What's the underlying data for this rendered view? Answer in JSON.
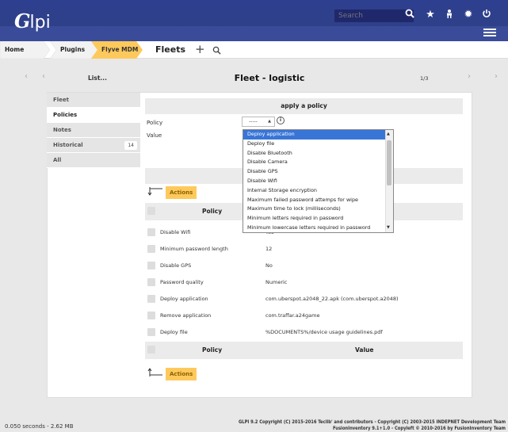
{
  "header": {
    "logo_text": "lpi",
    "logo_g": "G",
    "search_placeholder": "Search",
    "icons": [
      "search-icon",
      "star-icon",
      "user-icon",
      "gear-icon",
      "power-icon",
      "menu-icon"
    ]
  },
  "breadcrumb": {
    "items": [
      "Home",
      "Plugins",
      "Flyve MDM"
    ],
    "current": "Fleets"
  },
  "nav": {
    "list_label": "List...",
    "title": "Fleet - logistic",
    "counter": "1/3"
  },
  "tabs": [
    {
      "label": "Fleet"
    },
    {
      "label": "Policies"
    },
    {
      "label": "Notes"
    },
    {
      "label": "Historical",
      "count": "14"
    },
    {
      "label": "All"
    }
  ],
  "form": {
    "header": "apply a policy",
    "policy_label": "Policy",
    "value_label": "Value",
    "policy_selected": "-----"
  },
  "dropdown_options": [
    "Deploy application",
    "Deploy file",
    "Disable Bluetooth",
    "Disable Camera",
    "Disable GPS",
    "Disable Wifi",
    "Internal Storage encryption",
    "Maximum failed password attemps for wipe",
    "Maximum time to lock (milliseconds)",
    "Minimum letters required in password",
    "Minimum lowercase letters required in password"
  ],
  "actions_label": "Actions",
  "table": {
    "col_policy": "Policy",
    "col_value": "Value",
    "rows": [
      {
        "policy": "Disable Wifi",
        "value": "Yes"
      },
      {
        "policy": "Minimum password length",
        "value": "12"
      },
      {
        "policy": "Disable GPS",
        "value": "No"
      },
      {
        "policy": "Password quality",
        "value": "Numeric"
      },
      {
        "policy": "Deploy application",
        "value": "com.uberspot.a2048_22.apk (com.uberspot.a2048)"
      },
      {
        "policy": "Remove application",
        "value": "com.traffar.a24game"
      },
      {
        "policy": "Deploy file",
        "value": "%DOCUMENTS%/device usage guidelines.pdf"
      }
    ]
  },
  "footer": {
    "timing": "0.050 seconds - 2.62 MB",
    "copyright_1": "GLPI 9.2 Copyright (C) 2015-2016 Teclib' and contributors - Copyright (C) 2003-2015 INDEPNET Development Team",
    "copyright_2": "FusionInventory 9.1+1.0 - Copyleft © 2010-2016 by FusionInventory Team"
  },
  "colors": {
    "header": "#2e4089",
    "actions": "#fec95c",
    "breadcrumb_active": "#fec95c",
    "selected_option": "#3875d7"
  }
}
